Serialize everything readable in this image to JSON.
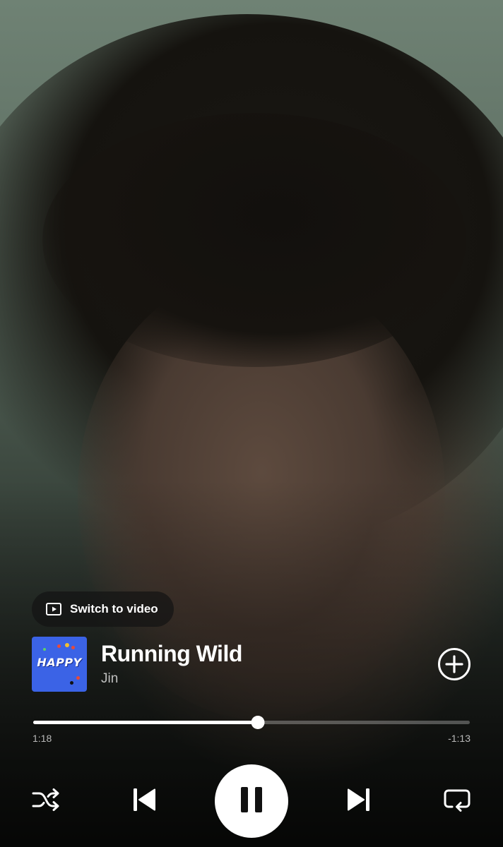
{
  "player": {
    "switch_video_label": "Switch to video",
    "track": {
      "title": "Running Wild",
      "artist": "Jin",
      "album_art_text": "HAPPY"
    },
    "progress": {
      "elapsed": "1:18",
      "remaining": "-1:13",
      "fraction": 0.515
    },
    "state": "playing",
    "icons": {
      "switch_video": "play-square-icon",
      "add": "plus-circle-icon",
      "shuffle": "shuffle-icon",
      "previous": "skip-previous-icon",
      "pause": "pause-icon",
      "next": "skip-next-icon",
      "repeat": "repeat-icon"
    },
    "colors": {
      "album_art": "#3b63e6",
      "control_foreground": "#ffffff",
      "play_button_bg": "#ffffff",
      "play_button_icon": "#111111"
    }
  }
}
